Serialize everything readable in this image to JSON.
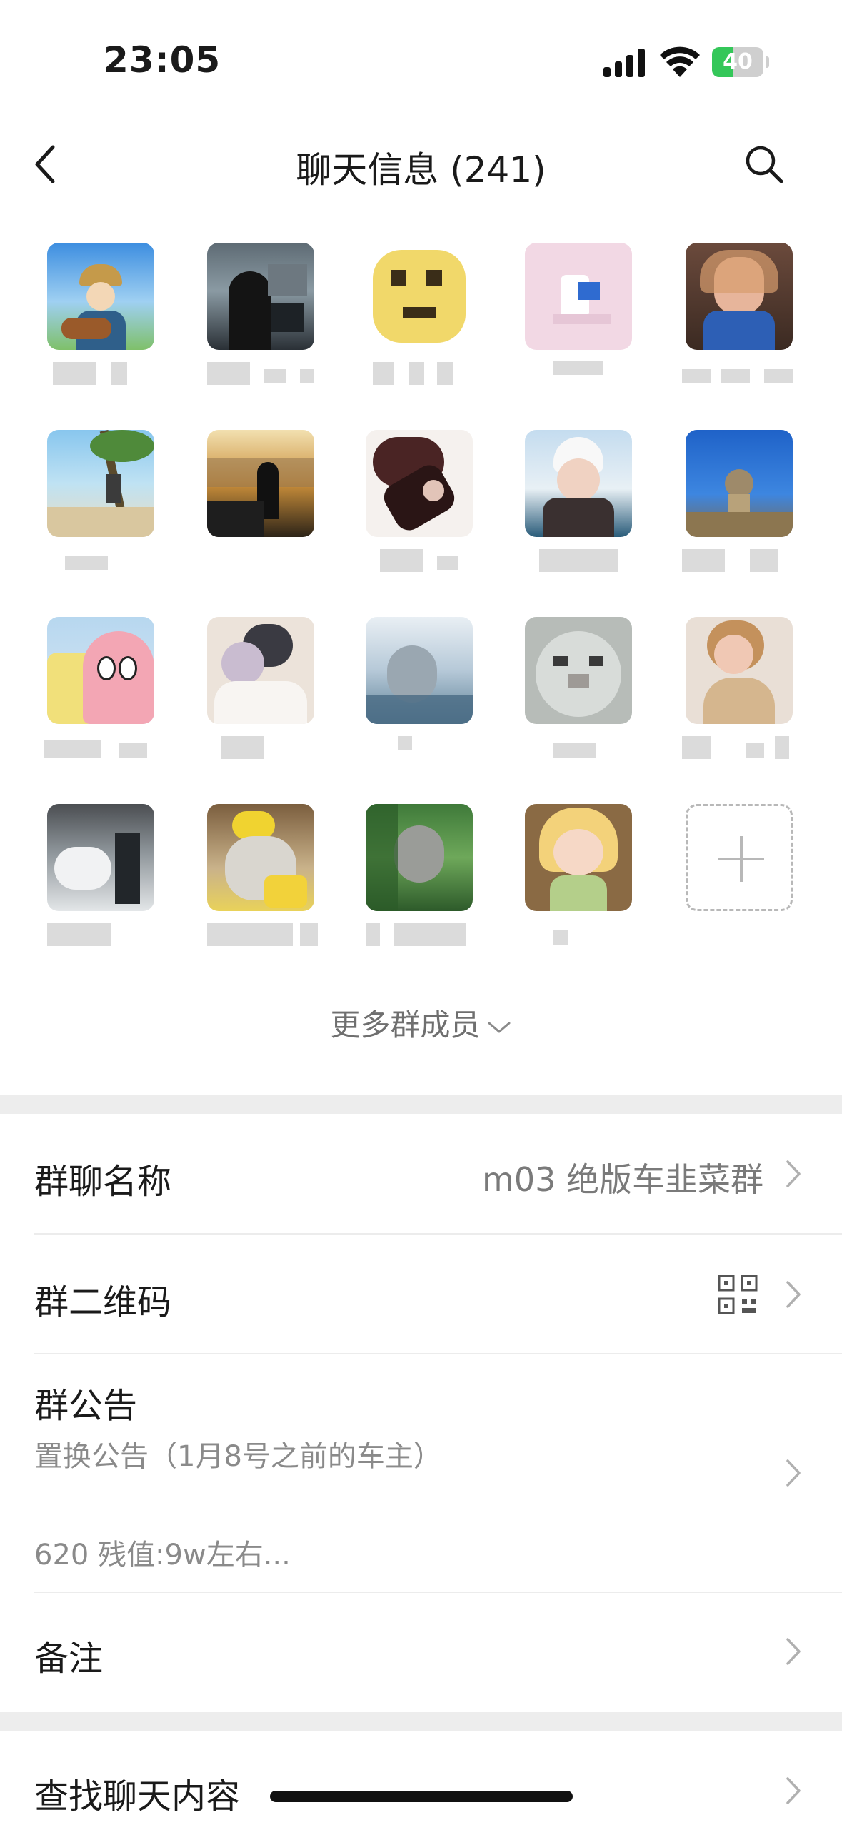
{
  "status_bar": {
    "time": "23:05",
    "battery_level": "40",
    "battery_fraction": 0.4,
    "battery_color": "#34c759",
    "icons": [
      "signal-icon",
      "wifi-icon",
      "battery-icon"
    ]
  },
  "nav": {
    "title": "聊天信息 (241)",
    "back_icon": "chevron-left-icon",
    "search_icon": "search-icon"
  },
  "members": {
    "more_label": "更多群成员",
    "add_icon": "plus-icon"
  },
  "settings": {
    "group_name_label": "群聊名称",
    "group_name_value": "m03 绝版车韭菜群",
    "qr_label": "群二维码",
    "announcement_label": "群公告",
    "announcement_line1": "置换公告（1月8号之前的车主）",
    "announcement_line2": "620 残值:9w左右...",
    "remark_label": "备注",
    "search_chat_label": "查找聊天内容"
  }
}
